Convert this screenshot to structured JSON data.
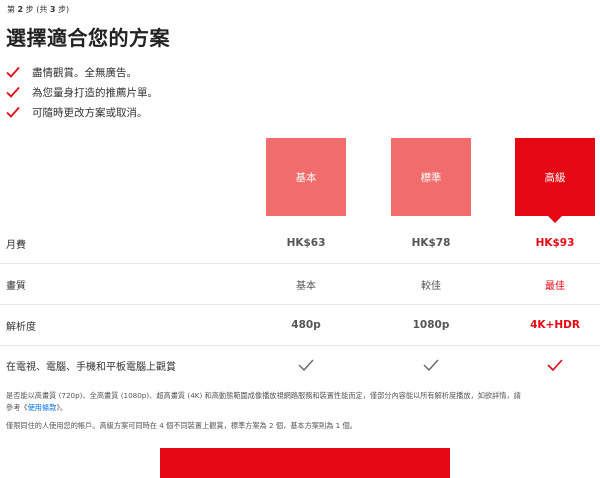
{
  "header": {
    "step_prefix": "第",
    "step_current": "2",
    "step_middle": "步 (共",
    "step_total": "3",
    "step_suffix": "步)",
    "title": "選擇適合您的方案"
  },
  "benefits": [
    {
      "text": "盡情觀賞。全無廣告。"
    },
    {
      "text": "為您量身打造的推薦片單。"
    },
    {
      "text": "可隨時更改方案或取消。"
    }
  ],
  "plans": [
    {
      "name": "基本",
      "color": "#f06c6d"
    },
    {
      "name": "標準",
      "color": "#f06c6d"
    },
    {
      "name": "高級",
      "color": "#e50914",
      "selected": true
    }
  ],
  "rows": {
    "price": {
      "label": "月費",
      "values": [
        "HK$63",
        "HK$78",
        "HK$93"
      ]
    },
    "quality": {
      "label": "畫質",
      "values": [
        "基本",
        "較佳",
        "最佳"
      ]
    },
    "resolution": {
      "label": "解析度",
      "values": [
        "480p",
        "1080p",
        "4K+HDR"
      ]
    },
    "devices": {
      "label": "在電視、電腦、手機和平板電腦上觀賞",
      "values": [
        "check-icon",
        "check-icon",
        "check-icon"
      ]
    }
  },
  "notes": {
    "note1_text": "是否能以高畫質 (720p)、全高畫質 (1080p)、超高畫質 (4K) 和高動態範圍成像播放視網路服務和裝置性能而定，僅部分內容能以所有解析度播放，如欲詳情，請參考《",
    "note1_link": "使用條款",
    "note1_end": "》。",
    "note2_text": "僅限同住的人使用您的帳戶。高級方案可同時在 4 個不同裝置上觀賞，標準方案為 2 個，基本方案則為 1 個。"
  },
  "colors": {
    "accent": "#e50914",
    "accent_light": "#f06c6d",
    "link": "#0071eb"
  }
}
